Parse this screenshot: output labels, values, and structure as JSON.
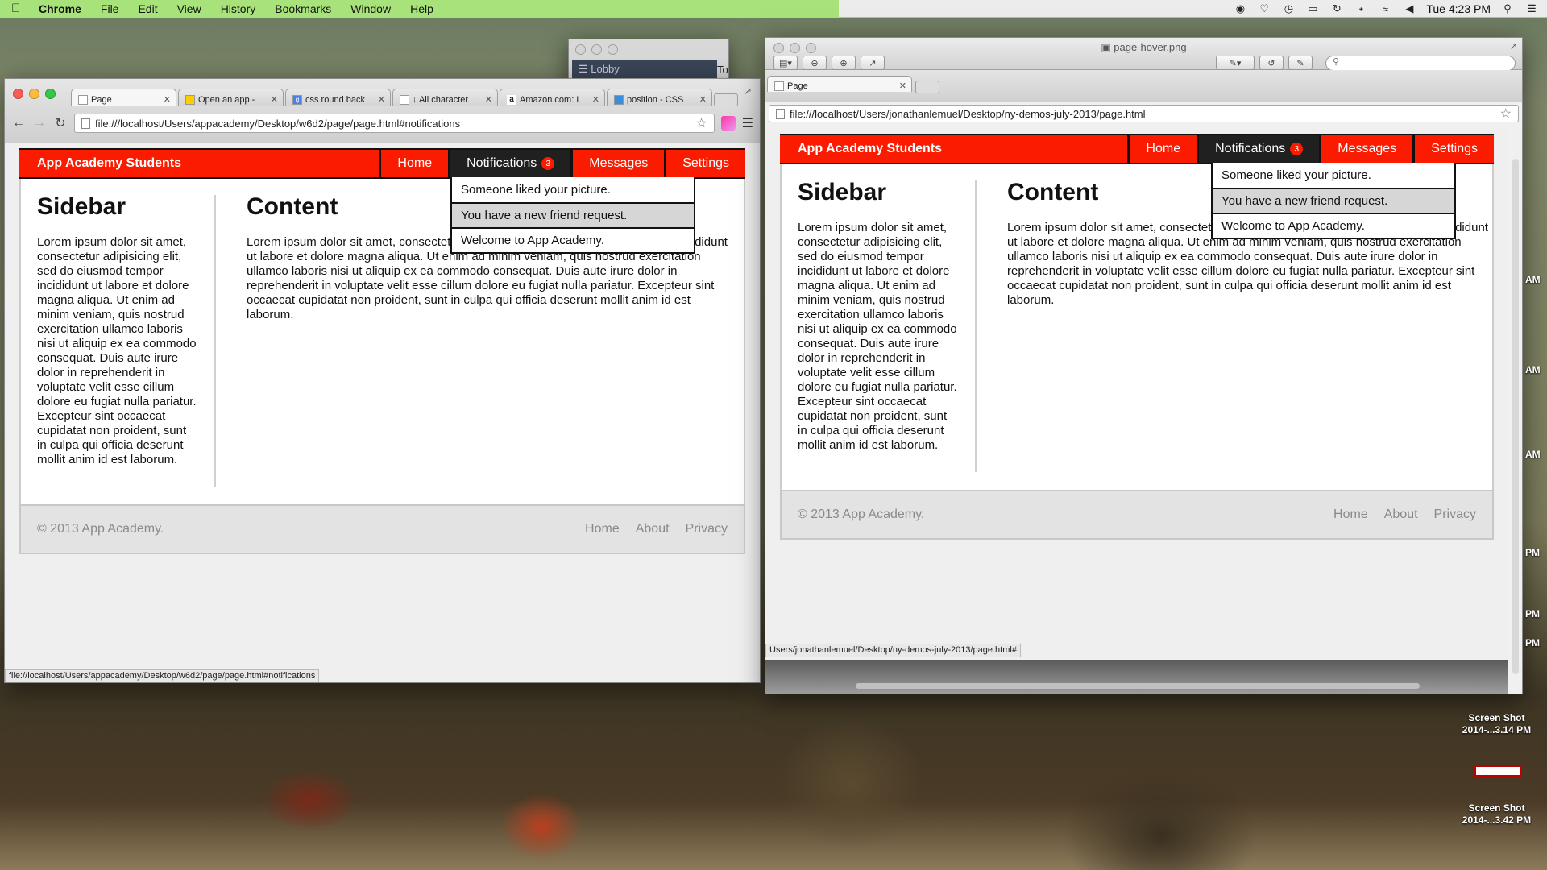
{
  "menubar": {
    "app_name": "Chrome",
    "items": [
      "File",
      "Edit",
      "View",
      "History",
      "Bookmarks",
      "Window",
      "Help"
    ],
    "clock": "Tue 4:23 PM"
  },
  "behind_window": {
    "sidebar_label": "Lobby",
    "tab_label": "Tommy"
  },
  "left_window": {
    "tabs": [
      {
        "label": "Page",
        "icon": "page-icon"
      },
      {
        "label": "Open an app -",
        "icon": "google-icon"
      },
      {
        "label": "css round back",
        "icon": "google-search-icon"
      },
      {
        "label": "↓ All character",
        "icon": "page-icon"
      },
      {
        "label": "Amazon.com: I",
        "icon": "amazon-icon"
      },
      {
        "label": "position - CSS",
        "icon": "stack-icon"
      }
    ],
    "url": "file:///localhost/Users/appacademy/Desktop/w6d2/page/page.html#notifications",
    "status_url": "file://localhost/Users/appacademy/Desktop/w6d2/page/page.html#notifications"
  },
  "right_window": {
    "title": "page-hover.png",
    "tab_label": "Page",
    "url": "file:///localhost/Users/jonathanlemuel/Desktop/ny-demos-july-2013/page.html",
    "status_url": "Users/jonathanlemuel/Desktop/ny-demos-july-2013/page.html#"
  },
  "site": {
    "brand": "App Academy Students",
    "nav": {
      "home": "Home",
      "notifications": "Notifications",
      "notifications_count": "3",
      "messages": "Messages",
      "settings": "Settings"
    },
    "notifications": [
      "Someone liked your picture.",
      "You have a new friend request.",
      "Welcome to App Academy."
    ],
    "sidebar_title": "Sidebar",
    "sidebar_text": "Lorem ipsum dolor sit amet, consectetur adipisicing elit, sed do eiusmod tempor incididunt ut labore et dolore magna aliqua. Ut enim ad minim veniam, quis nostrud exercitation ullamco laboris nisi ut aliquip ex ea commodo consequat. Duis aute irure dolor in reprehenderit in voluptate velit esse cillum dolore eu fugiat nulla pariatur. Excepteur sint occaecat cupidatat non proident, sunt in culpa qui officia deserunt mollit anim id est laborum.",
    "content_title": "Content",
    "content_text": "Lorem ipsum dolor sit amet, consectetur adipisicing elit, sed do eiusmod tempor incididunt ut labore et dolore magna aliqua. Ut enim ad minim veniam, quis nostrud exercitation ullamco laboris nisi ut aliquip ex ea commodo consequat. Duis aute irure dolor in reprehenderit in voluptate velit esse cillum dolore eu fugiat nulla pariatur. Excepteur sint occaecat cupidatat non proident, sunt in culpa qui officia deserunt mollit anim id est laborum.",
    "footer_copy": "© 2013 App Academy.",
    "footer_links": [
      "Home",
      "About",
      "Privacy"
    ]
  },
  "desktop": {
    "files": [
      {
        "name_line1": "Screen Shot",
        "name_line2": "2014-...3.14 PM"
      },
      {
        "name_line1": "Screen Shot",
        "name_line2": "2014-...3.42 PM"
      }
    ],
    "edge_labels": [
      "AM",
      "AM",
      "AM",
      "PM",
      "PM",
      "PM"
    ]
  }
}
